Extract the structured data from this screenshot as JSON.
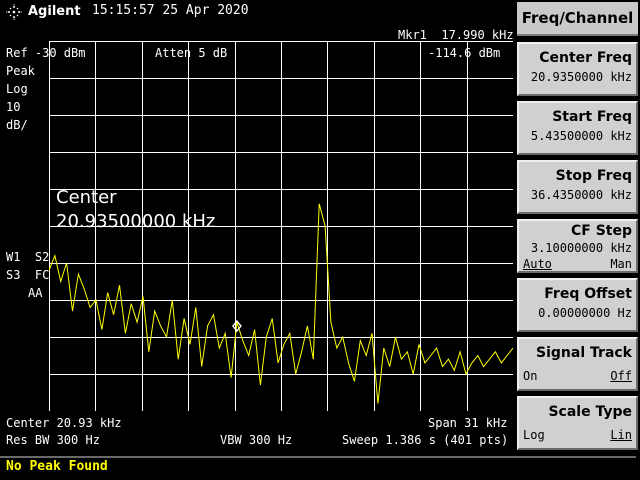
{
  "header": {
    "brand": "Agilent",
    "datetime": "15:15:57  25 Apr 2020",
    "marker_label": "Mkr1  17.990 kHz",
    "marker_level": "-114.6 dBm",
    "ref_level": "Ref -30 dBm",
    "attenuation": "Atten 5 dB"
  },
  "left_annotations": {
    "detector": "Peak",
    "scale_type": "Log",
    "scale_value": "10",
    "scale_unit": "dB/",
    "trace_line1": "W1  S2",
    "trace_line2": "S3  FC",
    "trace_line3": "AA"
  },
  "active_function": {
    "label": "Center",
    "value": "20.93500000 kHz"
  },
  "footer": {
    "center": "Center 20.93 kHz",
    "span": "Span 31 kHz",
    "res_bw": "Res BW 300 Hz",
    "vbw": "VBW 300 Hz",
    "sweep": "Sweep 1.386 s (401 pts)"
  },
  "menu": {
    "title": "Freq/Channel",
    "keys": [
      {
        "label": "Center Freq",
        "value": "20.9350000 kHz"
      },
      {
        "label": "Start Freq",
        "value": "5.43500000 kHz"
      },
      {
        "label": "Stop Freq",
        "value": "36.4350000 kHz"
      },
      {
        "label": "CF Step",
        "value": "3.10000000 kHz",
        "option_left": "Auto",
        "option_right": "Man"
      },
      {
        "label": "Freq Offset",
        "value": "0.00000000 Hz"
      },
      {
        "label": "Signal Track",
        "option_left": "On",
        "option_right": "Off"
      },
      {
        "label": "Scale Type",
        "option_left": "Log",
        "option_right": "Lin"
      }
    ]
  },
  "status_message": "No Peak Found",
  "colors": {
    "trace": "#ffff00",
    "grid": "#ffffff",
    "softkey_bg": "#d0d0d0",
    "message": "#ffff00"
  },
  "trace": {
    "description_free": true,
    "levels_db_below_ref": [
      -62,
      -58,
      -65,
      -60,
      -73,
      -63,
      -67,
      -72,
      -70,
      -78,
      -68,
      -74,
      -66,
      -79,
      -71,
      -76,
      -69,
      -84,
      -73,
      -77,
      -80,
      -70,
      -86,
      -75,
      -82,
      -72,
      -88,
      -77,
      -74,
      -83,
      -79,
      -91,
      -76,
      -81,
      -85,
      -78,
      -93,
      -80,
      -75,
      -87,
      -82,
      -79,
      -90,
      -84,
      -77,
      -86,
      -44,
      -50,
      -76,
      -83,
      -80,
      -87,
      -92,
      -81,
      -85,
      -79,
      -98,
      -83,
      -88,
      -80,
      -86,
      -84,
      -90,
      -82,
      -87,
      -85,
      -83,
      -88,
      -86,
      -89,
      -84,
      -90,
      -87,
      -85,
      -88,
      -86,
      -84,
      -87,
      -85,
      -83
    ],
    "marker_freq_khz": 17.99,
    "marker_level_dbm": -114.6,
    "center_khz": 20.935,
    "span_khz": 31,
    "ref_dbm": -30,
    "db_per_div": 10
  }
}
